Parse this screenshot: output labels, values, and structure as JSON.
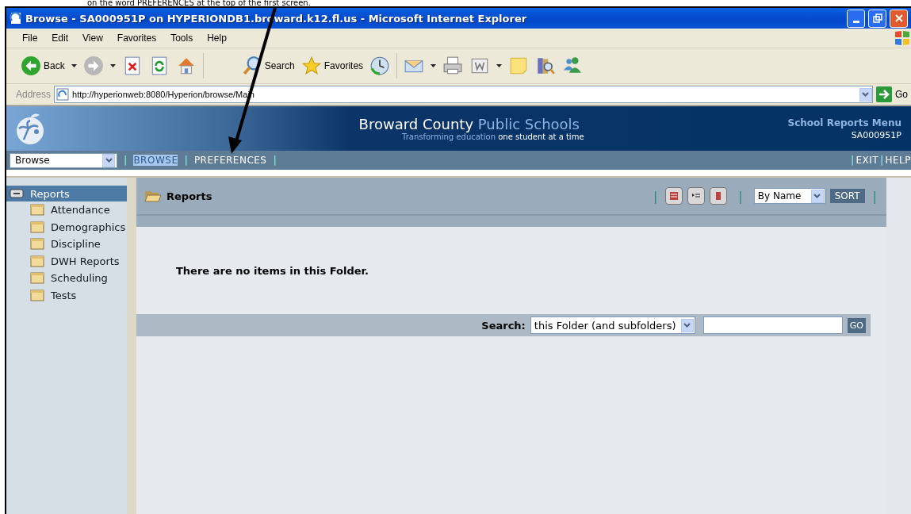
{
  "caption": "on the word PREFERENCES at the top of the first screen.",
  "window": {
    "title": "Browse - SA000951P on HYPERIONDB1.broward.k12.fl.us - Microsoft Internet Explorer"
  },
  "menu": [
    "File",
    "Edit",
    "View",
    "Favorites",
    "Tools",
    "Help"
  ],
  "toolbar": [
    {
      "kind": "back",
      "label": "Back"
    },
    {
      "kind": "forward"
    },
    {
      "kind": "stop"
    },
    {
      "kind": "refresh"
    },
    {
      "kind": "home"
    },
    {
      "kind": "search",
      "label": "Search"
    },
    {
      "kind": "favorites",
      "label": "Favorites"
    },
    {
      "kind": "history"
    },
    {
      "kind": "mail"
    },
    {
      "kind": "print"
    },
    {
      "kind": "edit"
    },
    {
      "kind": "note"
    },
    {
      "kind": "research"
    },
    {
      "kind": "messenger"
    }
  ],
  "address": {
    "label": "Address",
    "value": "http://hyperionweb:8080/Hyperion/browse/Main",
    "go": "Go"
  },
  "header": {
    "title": "Broward County",
    "title_accent": "Public Schools",
    "tagline": "Transforming education",
    "tagline_2": "one student at a time",
    "menu_title": "School Reports Menu",
    "user": "SA000951P"
  },
  "nav": {
    "dropdown": "Browse",
    "items": [
      {
        "kind": "separator",
        "text": "|"
      },
      {
        "kind": "link",
        "text": "BROWSE",
        "selected": true
      },
      {
        "kind": "separator",
        "text": "|"
      },
      {
        "kind": "link",
        "text": "PREFERENCES",
        "selected": false
      },
      {
        "kind": "separator",
        "text": "|"
      }
    ],
    "right_items": [
      {
        "kind": "separator",
        "text": "|"
      },
      {
        "kind": "link",
        "text": "EXIT",
        "selected": false
      },
      {
        "kind": "separator",
        "text": "|"
      },
      {
        "kind": "link",
        "text": "HELP",
        "selected": false
      }
    ]
  },
  "sidebar": {
    "root": {
      "label": "Reports",
      "selected": true,
      "children": [
        {
          "label": "Attendance",
          "selected": false
        },
        {
          "label": "Demographics",
          "selected": false
        },
        {
          "label": "Discipline",
          "selected": false
        },
        {
          "label": "DWH Reports",
          "selected": false
        },
        {
          "label": "Scheduling",
          "selected": false
        },
        {
          "label": "Tests",
          "selected": false
        }
      ]
    }
  },
  "content": {
    "folder": "Reports",
    "separators": [
      "|",
      "|",
      "|"
    ],
    "sort": {
      "value": "By Name",
      "button": "SORT"
    },
    "message": "There are no items in this Folder.",
    "search": {
      "label": "Search:",
      "scope": "this Folder (and subfolders)",
      "button": "GO"
    }
  }
}
